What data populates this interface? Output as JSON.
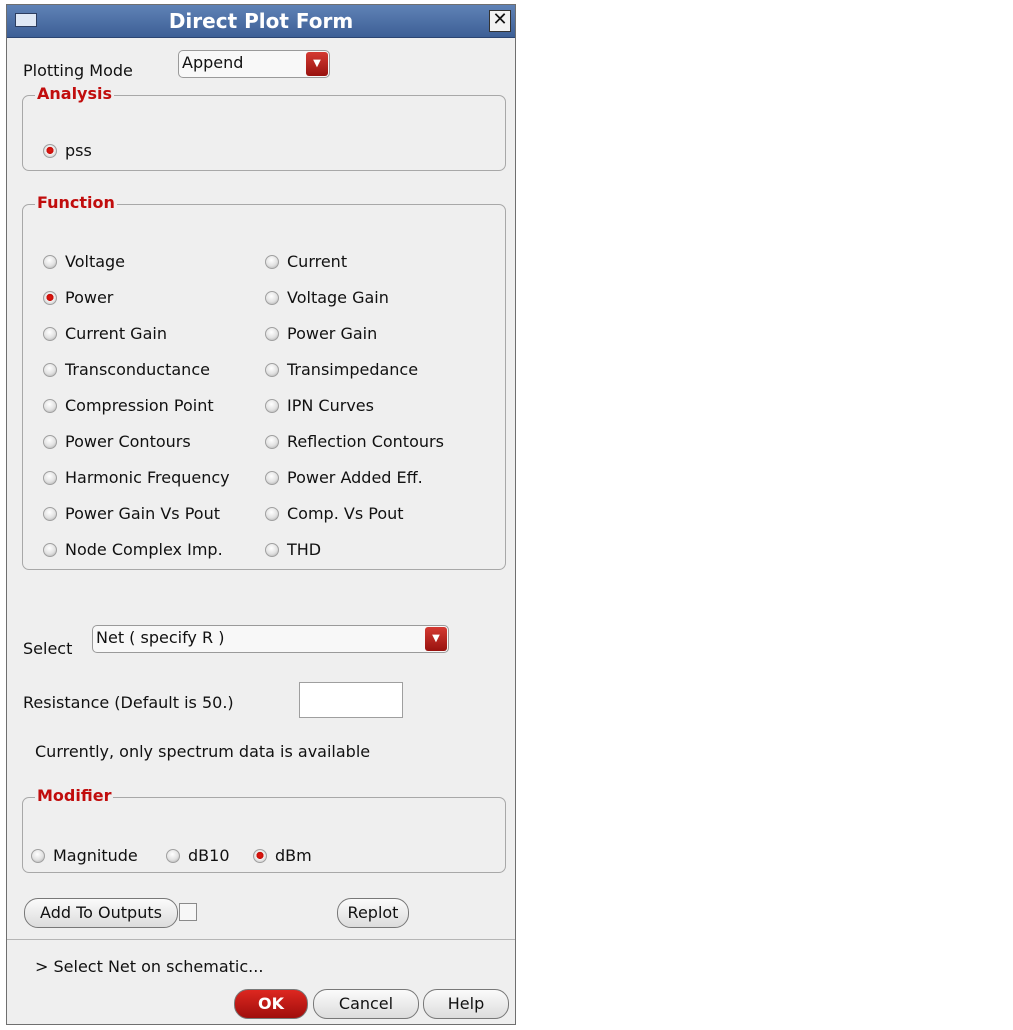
{
  "window": {
    "title": "Direct Plot Form",
    "close_icon": "close-icon",
    "menu_icon": "window-menu-icon"
  },
  "plotting_mode": {
    "label": "Plotting Mode",
    "value": "Append"
  },
  "analysis": {
    "title": "Analysis",
    "option": "pss"
  },
  "function": {
    "title": "Function",
    "left": [
      "Voltage",
      "Power",
      "Current Gain",
      "Transconductance",
      "Compression Point",
      "Power Contours",
      "Harmonic Frequency",
      "Power Gain Vs Pout",
      "Node Complex Imp."
    ],
    "right": [
      "Current",
      "Voltage Gain",
      "Power Gain",
      "Transimpedance",
      "IPN Curves",
      "Reflection Contours",
      "Power Added Eff.",
      "Comp. Vs Pout",
      "THD"
    ],
    "selected": "Power"
  },
  "select": {
    "label": "Select",
    "value": "Net ( specify R )"
  },
  "resistance": {
    "label": "Resistance (Default is 50.)",
    "value": ""
  },
  "spectrum_note": "Currently, only spectrum data is available",
  "modifier": {
    "title": "Modifier",
    "options": [
      "Magnitude",
      "dB10",
      "dBm"
    ],
    "selected": "dBm"
  },
  "buttons": {
    "add_to_outputs": "Add To Outputs",
    "replot": "Replot",
    "ok": "OK",
    "cancel": "Cancel",
    "help": "Help"
  },
  "status": "> Select Net on schematic...",
  "colors": {
    "title_bar": "#4c6ea7",
    "accent": "#c10d0d"
  }
}
